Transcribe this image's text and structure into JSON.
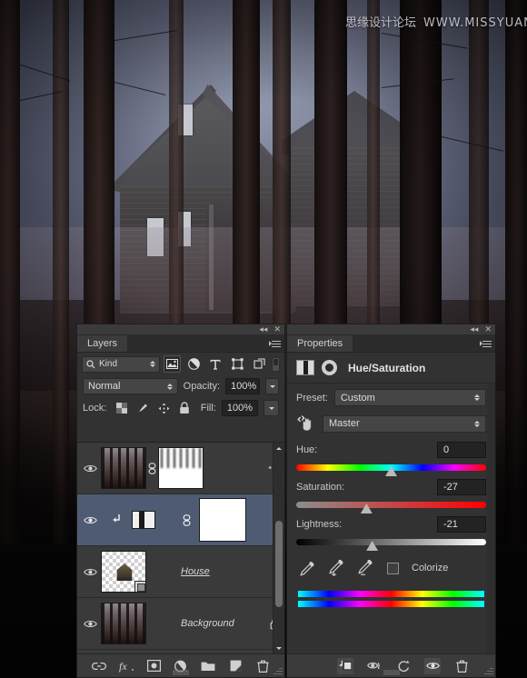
{
  "watermark": {
    "cn": "思缘设计论坛",
    "url": "WWW.MISSYUAN.COM"
  },
  "layers_panel": {
    "tab_label": "Layers",
    "collapse_label": "◂◂",
    "close_label": "✕",
    "filter": {
      "kind_label": "Kind",
      "search_icon": "search-icon",
      "icons": [
        "pixel-layer-filter-icon",
        "adjustment-layer-filter-icon",
        "type-layer-filter-icon",
        "shape-layer-filter-icon",
        "smart-object-filter-icon"
      ],
      "toggle_name": "filter-enable-toggle"
    },
    "blend_mode": "Normal",
    "opacity_label": "Opacity:",
    "opacity_value": "100%",
    "lock_label": "Lock:",
    "fill_label": "Fill:",
    "fill_value": "100%",
    "lock_icons": [
      "lock-transparent-pixels-icon",
      "lock-image-pixels-icon",
      "lock-position-icon",
      "lock-all-icon"
    ],
    "rows": [
      {
        "name": "",
        "type": "pixel-with-mask",
        "visible": true,
        "selected": false,
        "linked": true,
        "has_mask": true,
        "locked": false
      },
      {
        "name": "",
        "type": "hue-saturation-adjustment",
        "visible": true,
        "selected": true,
        "linked": true,
        "has_mask": true,
        "locked": false,
        "clipped": true
      },
      {
        "name": "House",
        "type": "smart-object",
        "visible": true,
        "selected": false,
        "linked": false,
        "has_mask": false,
        "locked": false
      },
      {
        "name": "Background",
        "type": "background",
        "visible": true,
        "selected": false,
        "linked": false,
        "has_mask": false,
        "locked": true
      }
    ],
    "bottom_icons": [
      "link-layers-icon",
      "add-layer-style-icon",
      "add-layer-mask-icon",
      "new-adjustment-layer-icon",
      "new-group-icon",
      "new-layer-icon",
      "delete-layer-icon"
    ]
  },
  "properties_panel": {
    "tab_label": "Properties",
    "collapse_label": "◂◂",
    "close_label": "✕",
    "title": "Hue/Saturation",
    "adjust_icon": "hue-saturation-adjustment-icon",
    "mask_icon": "layer-mask-icon",
    "preset_label": "Preset:",
    "preset_value": "Custom",
    "channel_value": "Master",
    "on_image_icon": "on-image-adjustment-hand-icon",
    "sliders": [
      {
        "label": "Hue:",
        "value": "0",
        "pos_pct": 50,
        "track": "hue"
      },
      {
        "label": "Saturation:",
        "value": "-27",
        "pos_pct": 37,
        "track": "sat"
      },
      {
        "label": "Lightness:",
        "value": "-21",
        "pos_pct": 40,
        "track": "lig"
      }
    ],
    "eyedroppers": [
      "eyedropper-icon",
      "eyedropper-add-icon",
      "eyedropper-subtract-icon"
    ],
    "colorize_label": "Colorize",
    "colorize_checked": false,
    "bottom_icons": [
      "clip-to-layer-icon",
      "view-previous-state-icon",
      "reset-icon",
      "toggle-layer-visibility-icon",
      "delete-adjustment-icon"
    ]
  },
  "colors": {
    "panel_bg": "#323232",
    "panel_header": "#3b3b3b",
    "selection_blue": "#4e5b73",
    "text": "#c2c2c2"
  }
}
